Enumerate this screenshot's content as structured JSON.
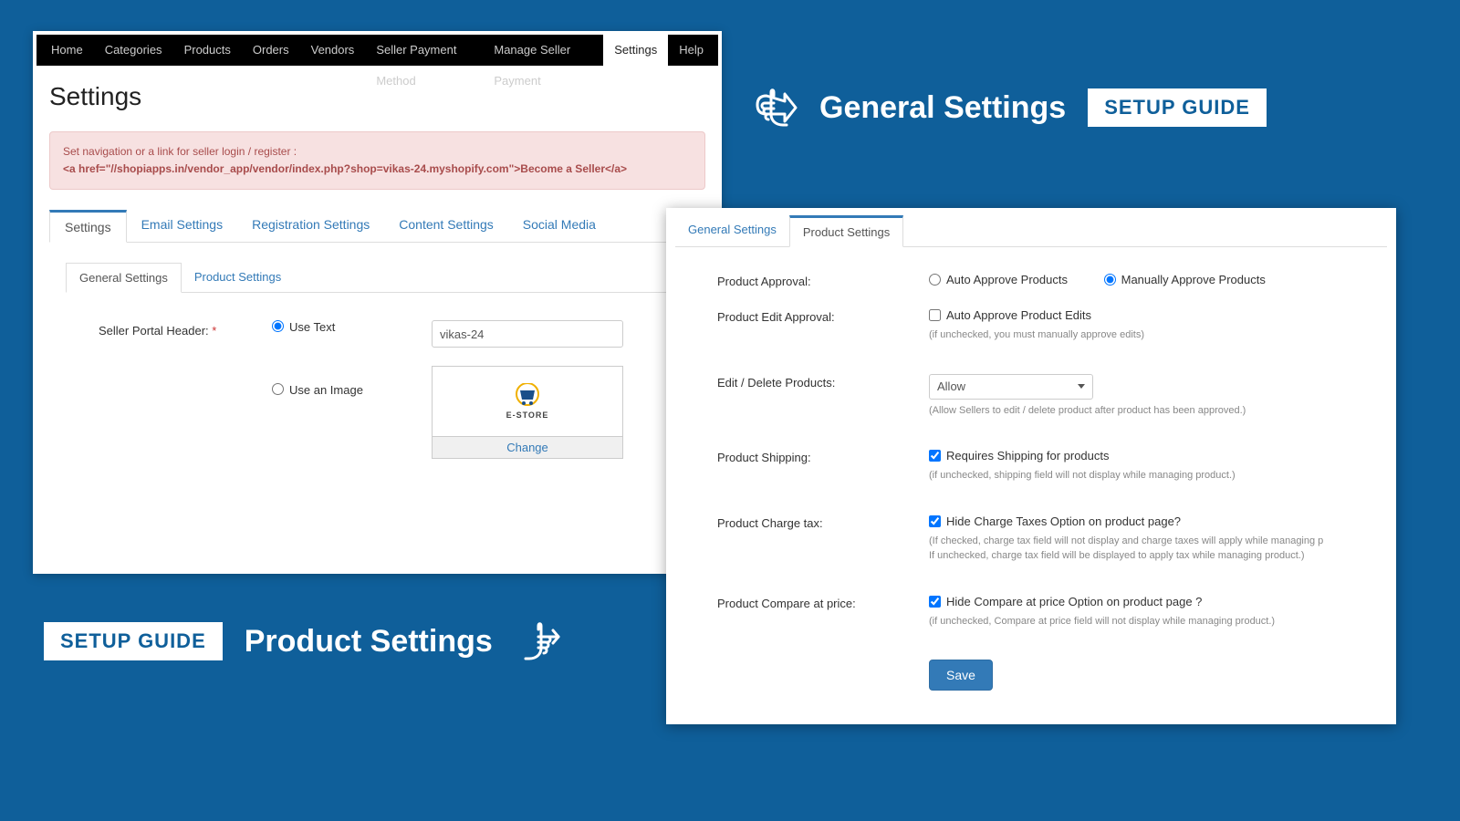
{
  "nav": {
    "items": [
      {
        "label": "Home"
      },
      {
        "label": "Categories"
      },
      {
        "label": "Products"
      },
      {
        "label": "Orders"
      },
      {
        "label": "Vendors"
      },
      {
        "label": "Seller Payment Method"
      },
      {
        "label": "Manage Seller Payment"
      },
      {
        "label": "Settings"
      },
      {
        "label": "Help"
      }
    ],
    "active": "Settings"
  },
  "page": {
    "title": "Settings",
    "alert_line1": "Set navigation or a link for seller login / register :",
    "alert_line2": "<a href=\"//shopiapps.in/vendor_app/vendor/index.php?shop=vikas-24.myshopify.com\">Become a Seller</a>"
  },
  "outer_tabs": {
    "items": [
      {
        "label": "Settings"
      },
      {
        "label": "Email Settings"
      },
      {
        "label": "Registration Settings"
      },
      {
        "label": "Content Settings"
      },
      {
        "label": "Social Media"
      }
    ],
    "active": "Settings"
  },
  "inner_tabs": {
    "items": [
      {
        "label": "General Settings"
      },
      {
        "label": "Product Settings"
      }
    ],
    "active": "General Settings"
  },
  "general_form": {
    "portal_header_label": "Seller Portal Header:",
    "required": "*",
    "opt_text": "Use Text",
    "opt_image": "Use an Image",
    "text_value": "vikas-24",
    "logo_label": "E-STORE",
    "change": "Change"
  },
  "right_tabs": {
    "items": [
      {
        "label": "General Settings"
      },
      {
        "label": "Product Settings"
      }
    ],
    "active": "Product Settings"
  },
  "product_form": {
    "approval_label": "Product Approval:",
    "approval_auto": "Auto Approve Products",
    "approval_manual": "Manually Approve Products",
    "edit_approval_label": "Product Edit Approval:",
    "edit_approval_check": "Auto Approve Product Edits",
    "edit_approval_hint": "(if unchecked, you must manually approve edits)",
    "edit_delete_label": "Edit / Delete Products:",
    "edit_delete_value": "Allow",
    "edit_delete_hint": "(Allow Sellers to edit / delete product after product has been approved.)",
    "shipping_label": "Product Shipping:",
    "shipping_check": "Requires Shipping for products",
    "shipping_hint": "(if unchecked, shipping field will not display while managing product.)",
    "tax_label": "Product Charge tax:",
    "tax_check": "Hide Charge Taxes Option on product page?",
    "tax_hint1": "(If checked, charge tax field will not display and charge taxes will apply while managing p",
    "tax_hint2": "If unchecked, charge tax field will be displayed to apply tax while managing product.)",
    "compare_label": "Product Compare at price:",
    "compare_check": "Hide Compare at price Option on product page ?",
    "compare_hint": "(if unchecked, Compare at price field will not display while managing product.)",
    "save": "Save"
  },
  "headlines": {
    "general": "General Settings",
    "product": "Product Settings",
    "guide": "SETUP GUIDE"
  }
}
